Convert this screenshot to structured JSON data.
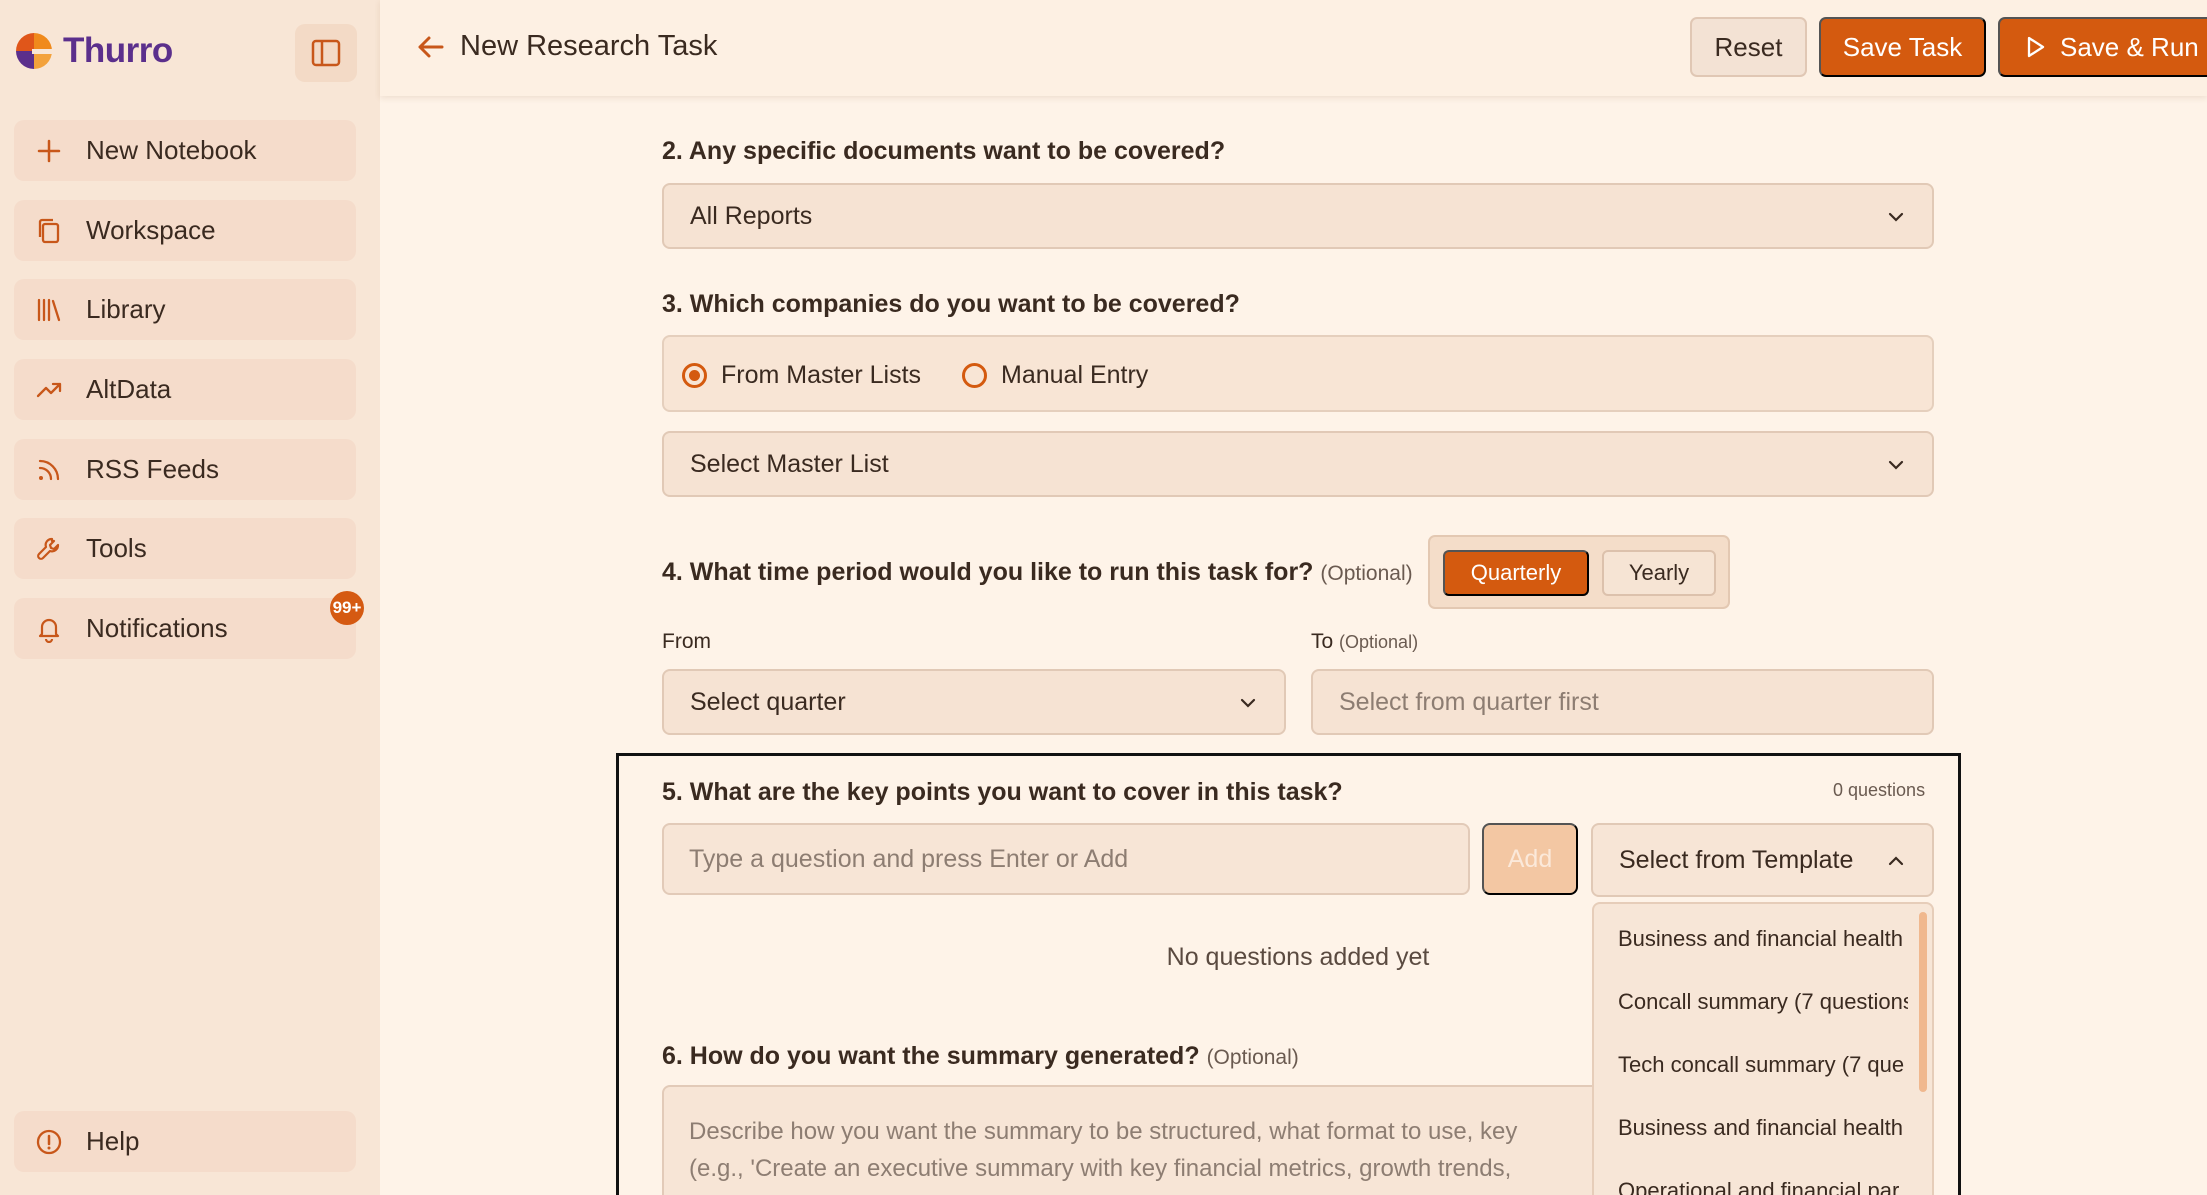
{
  "app": {
    "logo_text": "Thurro",
    "brand_colors": {
      "accent": "#d45a0f",
      "logo_purple": "#5b2f8c",
      "logo_orange": "#f08a1c"
    }
  },
  "sidebar": {
    "items": [
      {
        "label": "New Notebook",
        "icon": "plus-icon"
      },
      {
        "label": "Workspace",
        "icon": "copy-icon"
      },
      {
        "label": "Library",
        "icon": "library-icon"
      },
      {
        "label": "AltData",
        "icon": "trending-up-icon"
      },
      {
        "label": "RSS Feeds",
        "icon": "rss-icon"
      },
      {
        "label": "Tools",
        "icon": "wrench-icon"
      },
      {
        "label": "Notifications",
        "icon": "bell-icon"
      }
    ],
    "notification_badge": "99+",
    "help_label": "Help"
  },
  "header": {
    "title": "New Research Task",
    "reset_label": "Reset",
    "save_label": "Save Task",
    "save_run_label": "Save & Run"
  },
  "form": {
    "q2": {
      "label": "2. Any specific documents want to be covered?",
      "value": "All Reports"
    },
    "q3": {
      "label": "3. Which companies do you want to be covered?",
      "radio_master": "From Master Lists",
      "radio_manual": "Manual Entry",
      "selected": "From Master Lists",
      "master_list_placeholder": "Select Master List"
    },
    "q4": {
      "label": "4. What time period would you like to run this task for?",
      "optional": "(Optional)",
      "toggle_quarterly": "Quarterly",
      "toggle_yearly": "Yearly",
      "active_toggle": "Quarterly",
      "from_label": "From",
      "to_label": "To",
      "to_optional": "(Optional)",
      "from_placeholder": "Select quarter",
      "to_placeholder": "Select from quarter first"
    },
    "q5": {
      "label": "5. What are the key points you want to cover in this task?",
      "count": "0 questions",
      "input_placeholder": "Type a question and press Enter or Add",
      "add_label": "Add",
      "template_placeholder": "Select from Template",
      "empty_message": "No questions added yet",
      "templates": [
        "Business and financial health",
        "Concall summary (7 questions",
        "Tech concall summary (7 que",
        "Business and financial health",
        "Operational and financial par"
      ]
    },
    "q6": {
      "label": "6. How do you want the summary generated?",
      "optional": "(Optional)",
      "placeholder_line1": "Describe how you want the summary to be structured, what format to use, key",
      "placeholder_line2": "(e.g., 'Create an executive summary with key financial metrics, growth trends,"
    }
  }
}
